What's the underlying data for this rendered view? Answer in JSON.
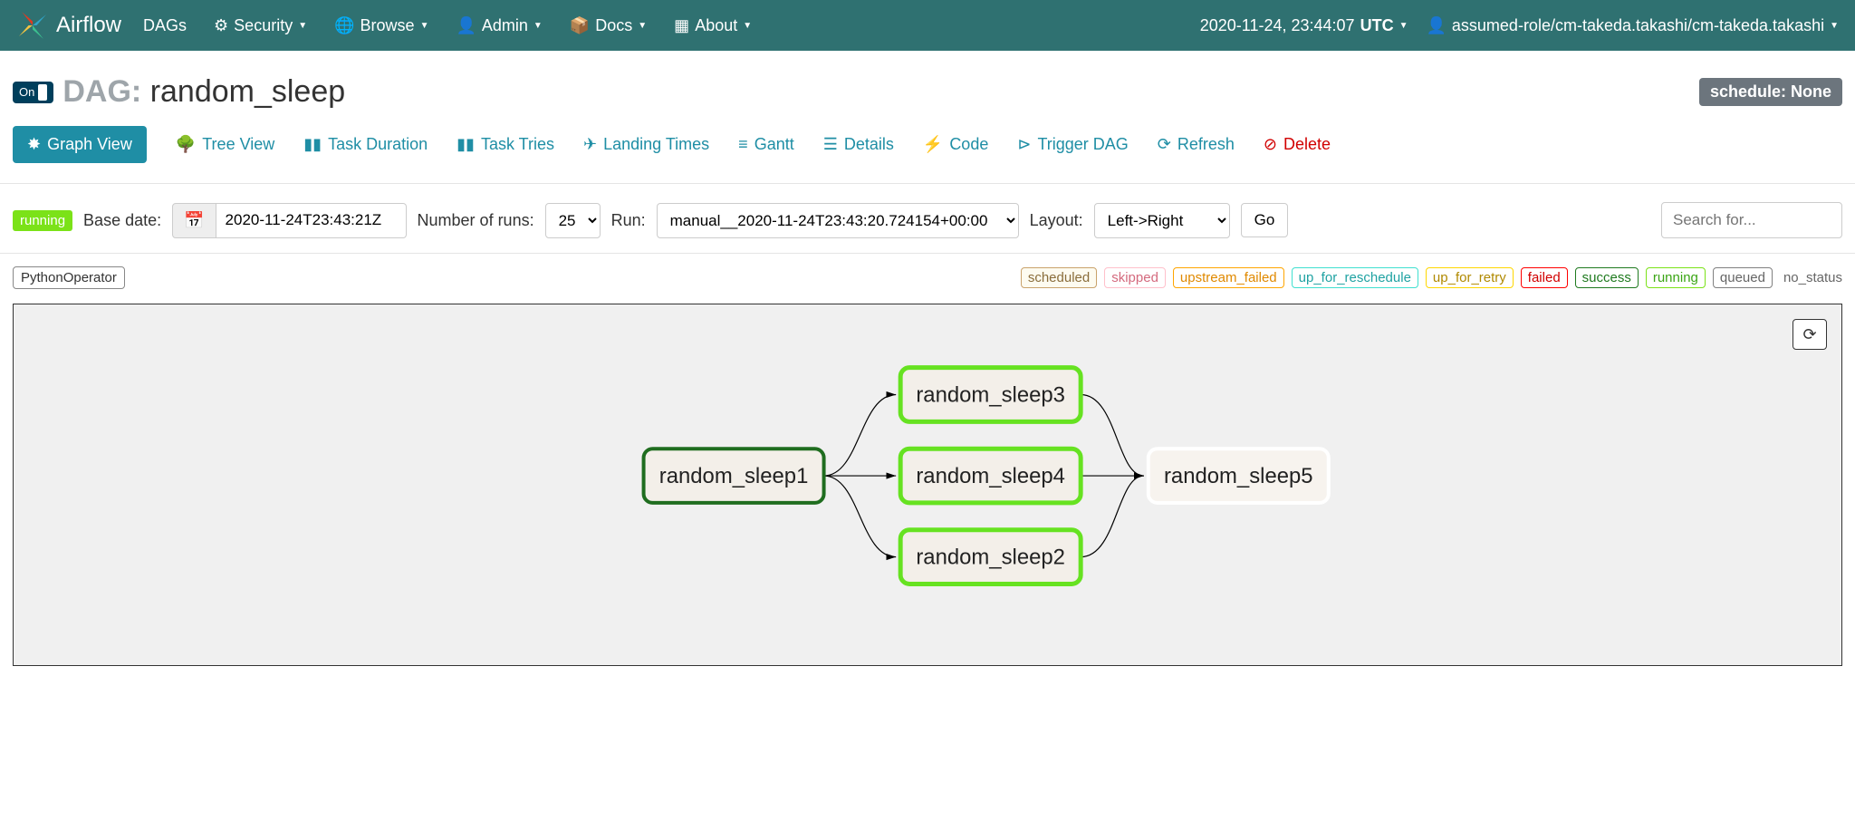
{
  "brand": "Airflow",
  "nav": {
    "items": [
      "DAGs",
      "Security",
      "Browse",
      "Admin",
      "Docs",
      "About"
    ],
    "clock": "2020-11-24, 23:44:07",
    "tz": "UTC",
    "user": "assumed-role/cm-takeda.takashi/cm-takeda.takashi"
  },
  "header": {
    "toggle": "On",
    "prefix": "DAG:",
    "name": "random_sleep",
    "schedule": "schedule: None"
  },
  "tabs": [
    "Graph View",
    "Tree View",
    "Task Duration",
    "Task Tries",
    "Landing Times",
    "Gantt",
    "Details",
    "Code",
    "Trigger DAG",
    "Refresh",
    "Delete"
  ],
  "controls": {
    "state_badge": "running",
    "base_date_label": "Base date:",
    "base_date_value": "2020-11-24T23:43:21Z",
    "runs_label": "Number of runs:",
    "runs_value": "25",
    "run_label": "Run:",
    "run_value": "manual__2020-11-24T23:43:20.724154+00:00",
    "layout_label": "Layout:",
    "layout_value": "Left->Right",
    "go": "Go",
    "search_placeholder": "Search for..."
  },
  "legend": {
    "operator": "PythonOperator",
    "statuses": [
      "scheduled",
      "skipped",
      "upstream_failed",
      "up_for_reschedule",
      "up_for_retry",
      "failed",
      "success",
      "running",
      "queued"
    ],
    "no_status": "no_status"
  },
  "graph": {
    "nodes": [
      {
        "id": "random_sleep1",
        "state": "success",
        "border": "#1f6d1f"
      },
      {
        "id": "random_sleep3",
        "state": "running",
        "border": "#7be218"
      },
      {
        "id": "random_sleep4",
        "state": "running",
        "border": "#7be218"
      },
      {
        "id": "random_sleep2",
        "state": "running",
        "border": "#7be218"
      },
      {
        "id": "random_sleep5",
        "state": "none",
        "border": "#ffffff"
      }
    ],
    "edges": [
      [
        "random_sleep1",
        "random_sleep3"
      ],
      [
        "random_sleep1",
        "random_sleep4"
      ],
      [
        "random_sleep1",
        "random_sleep2"
      ],
      [
        "random_sleep3",
        "random_sleep5"
      ],
      [
        "random_sleep4",
        "random_sleep5"
      ],
      [
        "random_sleep2",
        "random_sleep5"
      ]
    ]
  }
}
